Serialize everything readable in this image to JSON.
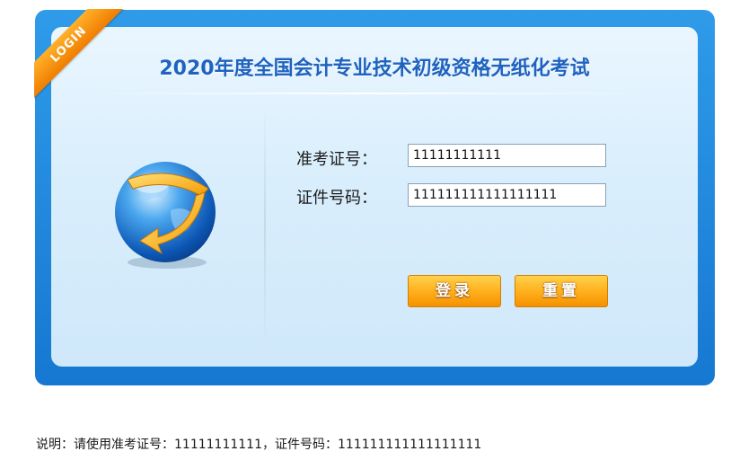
{
  "ribbon": {
    "label": "LOGIN"
  },
  "header": {
    "title": "2020年度全国会计专业技术初级资格无纸化考试"
  },
  "form": {
    "exam_id": {
      "label": "准考证号：",
      "value": "11111111111"
    },
    "id_number": {
      "label": "证件号码：",
      "value": "111111111111111111"
    }
  },
  "buttons": {
    "login": "登录",
    "reset": "重置"
  },
  "footer": {
    "note": "说明：请使用准考证号：11111111111，证件号码：111111111111111111"
  },
  "icons": {
    "globe": "globe-with-arrow-icon"
  },
  "colors": {
    "frame": "#1f86dc",
    "title": "#1f63bf",
    "button": "#ffad1a"
  }
}
